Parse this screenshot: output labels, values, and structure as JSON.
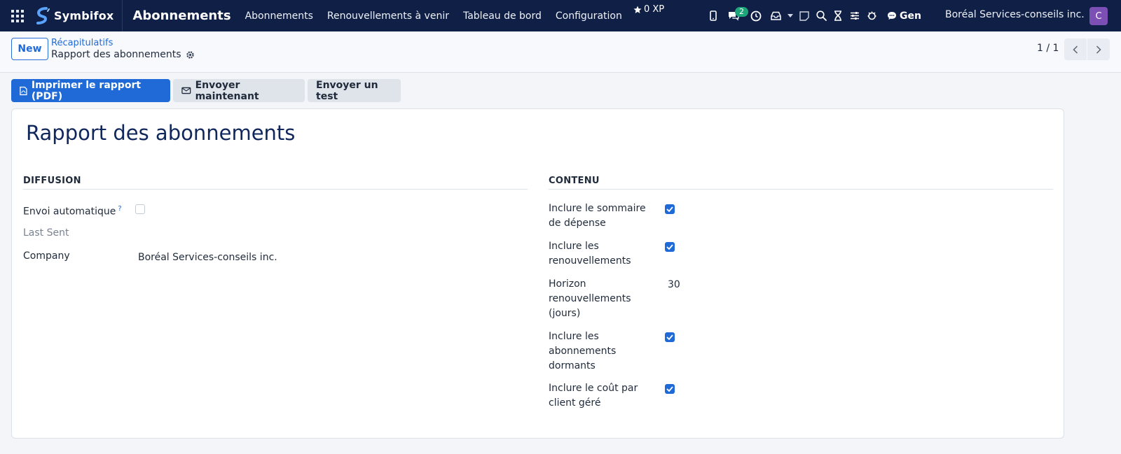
{
  "navbar": {
    "brand": "Symbifox",
    "app_title": "Abonnements",
    "menu": [
      "Abonnements",
      "Renouvellements à venir",
      "Tableau de bord",
      "Configuration"
    ],
    "xp": "0 XP",
    "chat_badge": "2",
    "gen_label": "Gen",
    "company": "Boréal Services-conseils inc.",
    "avatar_initial": "C"
  },
  "control_panel": {
    "new_label": "New",
    "breadcrumb_parent": "Récapitulatifs",
    "breadcrumb_current": "Rapport des abonnements",
    "pager": "1 / 1"
  },
  "actions": {
    "print_label": "Imprimer le rapport (PDF)",
    "send_now_label": "Envoyer maintenant",
    "send_test_label": "Envoyer un test"
  },
  "form": {
    "title": "Rapport des abonnements",
    "diffusion": {
      "title": "DIFFUSION",
      "auto_send_label": "Envoi automatique",
      "auto_send_tip": "?",
      "auto_send_value": false,
      "last_sent_label": "Last Sent",
      "last_sent_value": "",
      "company_label": "Company",
      "company_value": "Boréal Services-conseils inc."
    },
    "contenu": {
      "title": "CONTENU",
      "expense_summary_label": "Inclure le sommaire de dépense",
      "expense_summary_value": true,
      "renewals_label": "Inclure les renouvellements",
      "renewals_value": true,
      "horizon_label": "Horizon renouvellements (jours)",
      "horizon_value": "30",
      "dormant_label": "Inclure les abonnements dormants",
      "dormant_value": true,
      "cost_per_client_label": "Inclure le coût par client géré",
      "cost_per_client_value": true
    }
  },
  "colors": {
    "navbar": "#0f1f46",
    "primary": "#1f6ad6",
    "avatar": "#7b4fb3",
    "badge": "#1fa57a"
  }
}
